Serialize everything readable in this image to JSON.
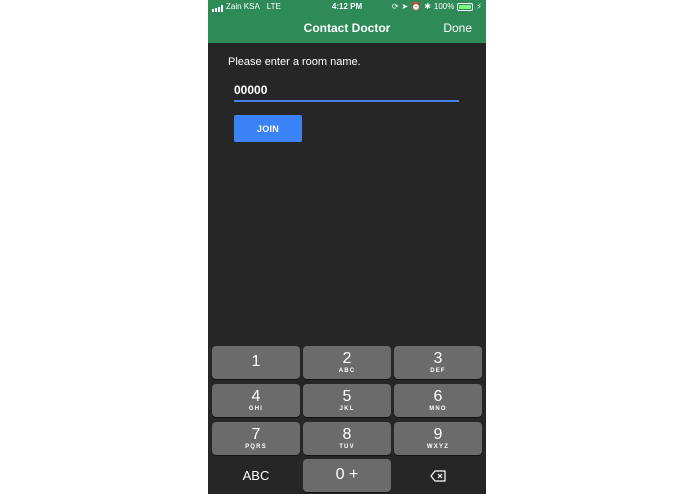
{
  "status_bar": {
    "carrier": "Zain KSA",
    "network": "LTE",
    "time": "4:12 PM",
    "battery": "100%",
    "battery_level": 1.0
  },
  "nav": {
    "title": "Contact Doctor",
    "done_label": "Done"
  },
  "form": {
    "prompt": "Please enter a room name.",
    "room_value": "00000",
    "join_label": "JOIN"
  },
  "keypad": {
    "keys": [
      {
        "digit": "1",
        "letters": ""
      },
      {
        "digit": "2",
        "letters": "ABC"
      },
      {
        "digit": "3",
        "letters": "DEF"
      },
      {
        "digit": "4",
        "letters": "GHI"
      },
      {
        "digit": "5",
        "letters": "JKL"
      },
      {
        "digit": "6",
        "letters": "MNO"
      },
      {
        "digit": "7",
        "letters": "PQRS"
      },
      {
        "digit": "8",
        "letters": "TUV"
      },
      {
        "digit": "9",
        "letters": "WXYZ"
      }
    ],
    "abc_label": "ABC",
    "zero_label": "0 +",
    "delete_icon": "backspace-icon"
  },
  "colors": {
    "header": "#2e8b57",
    "background": "#262626",
    "accent": "#3b82f6",
    "key": "#6b6b6b"
  }
}
